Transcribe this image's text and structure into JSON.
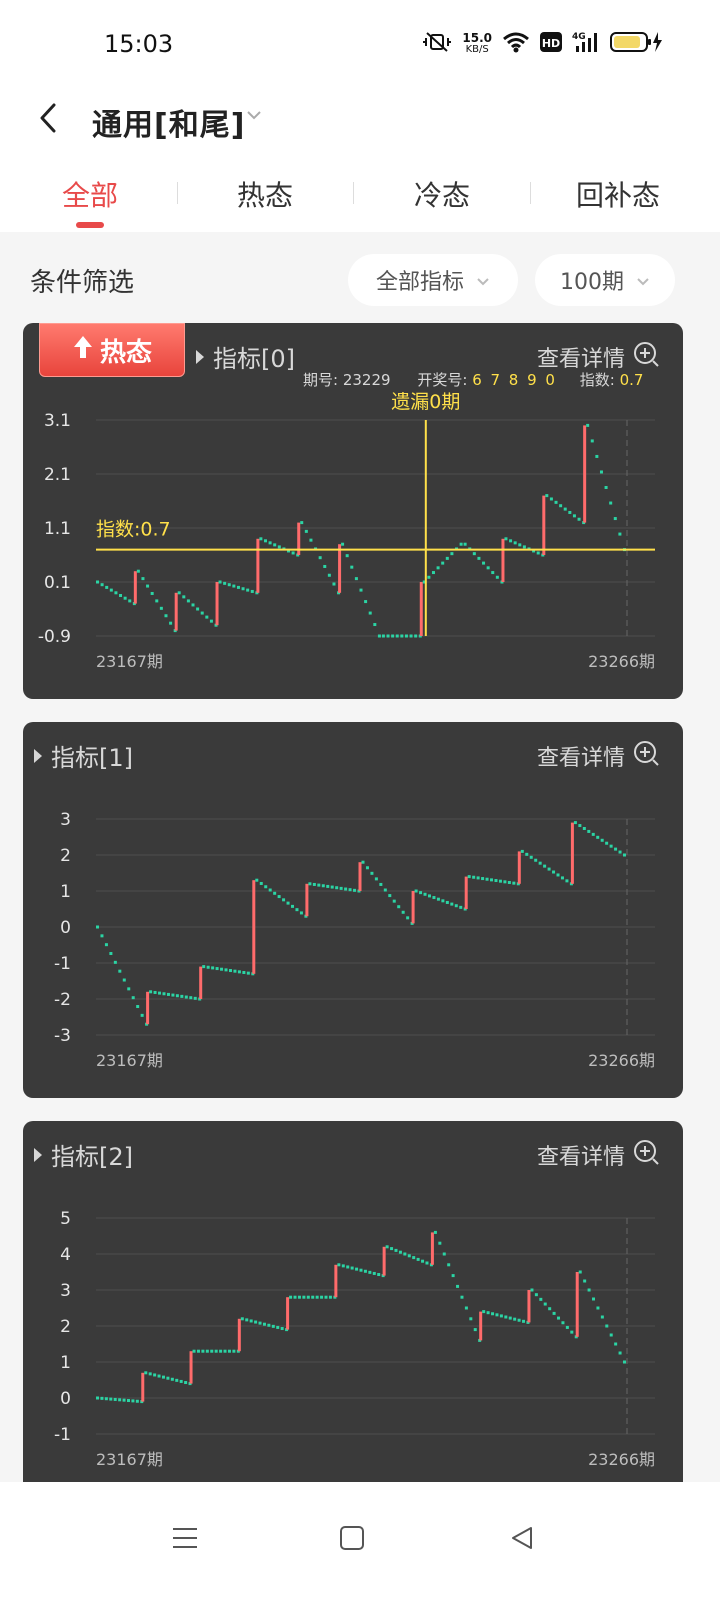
{
  "status": {
    "time": "15:03",
    "net_speed": "15.0",
    "net_unit": "KB/S",
    "hd_label": "HD",
    "signal_label": "4G"
  },
  "header": {
    "title": "通用[和尾]",
    "back_icon": "back-arrow-icon",
    "dropdown_icon": "chevron-down-icon"
  },
  "tabs": [
    {
      "label": "全部",
      "active": true
    },
    {
      "label": "热态",
      "active": false
    },
    {
      "label": "冷态",
      "active": false
    },
    {
      "label": "回补态",
      "active": false
    }
  ],
  "filter": {
    "label": "条件筛选",
    "indicator_select": "全部指标",
    "period_select": "100期"
  },
  "detail_label": "查看详情",
  "colors": {
    "accent": "#e84a4a",
    "up_bar": "#ff6b6b",
    "down_step": "#2bd4a4",
    "crosshair": "#ffe04a",
    "panel_bg": "#3a3a3a"
  },
  "panels": [
    {
      "title": "指标[0]",
      "badge": "热态",
      "info": {
        "period_label": "期号:",
        "period": "23229",
        "draw_label": "开奖号:",
        "draw": "6 7 8 9 0",
        "index_label": "指数:",
        "index": "0.7"
      },
      "miss_label": "遗漏0期",
      "ref_label": "指数:0.7",
      "start_label": "23167期",
      "end_label": "23266期"
    },
    {
      "title": "指标[1]",
      "start_label": "23167期",
      "end_label": "23266期"
    },
    {
      "title": "指标[2]",
      "start_label": "23167期",
      "end_label": "23266期"
    }
  ],
  "chart_data": [
    {
      "type": "line",
      "title": "指标[0]",
      "x": [
        "23167期",
        "23266期"
      ],
      "y_ticks": [
        3.1,
        2.1,
        1.1,
        0.1,
        -0.9
      ],
      "ylim": [
        -0.9,
        3.1
      ],
      "grid": true,
      "reference_line": 0.7,
      "crosshair_period": "23229",
      "segments": [
        {
          "from": 0.1,
          "to": -0.3,
          "up_to": 0.3
        },
        {
          "from": 0.3,
          "to": -0.8,
          "up_to": -0.1
        },
        {
          "from": -0.1,
          "to": -0.7,
          "up_to": 0.1
        },
        {
          "from": 0.1,
          "to": -0.1,
          "up_to": 0.9
        },
        {
          "from": 0.9,
          "to": 0.6,
          "up_to": 1.2
        },
        {
          "from": 1.2,
          "to": -0.1,
          "up_to": 0.8
        },
        {
          "from": 0.8,
          "to": -0.9,
          "up_to": -0.9
        },
        {
          "from": -0.9,
          "to": -0.9,
          "up_to": 0.1
        },
        {
          "from": 0.1,
          "to": 0.8,
          "up_to": 0.8
        },
        {
          "from": 0.8,
          "to": 0.1,
          "up_to": 0.9
        },
        {
          "from": 0.9,
          "to": 0.6,
          "up_to": 1.7
        },
        {
          "from": 1.7,
          "to": 1.2,
          "up_to": 3.0
        },
        {
          "from": 3.0,
          "to": 0.7,
          "up_to": 0.7
        }
      ]
    },
    {
      "type": "line",
      "title": "指标[1]",
      "x": [
        "23167期",
        "23266期"
      ],
      "y_ticks": [
        3,
        2,
        1,
        0,
        -1,
        -2,
        -3
      ],
      "ylim": [
        -3,
        3
      ],
      "grid": true,
      "segments": [
        {
          "from": 0.0,
          "to": -2.7,
          "up_to": -1.8
        },
        {
          "from": -1.8,
          "to": -2.0,
          "up_to": -1.1
        },
        {
          "from": -1.1,
          "to": -1.3,
          "up_to": 1.3
        },
        {
          "from": 1.3,
          "to": 0.3,
          "up_to": 1.2
        },
        {
          "from": 1.2,
          "to": 1.0,
          "up_to": 1.8
        },
        {
          "from": 1.8,
          "to": 0.1,
          "up_to": 1.0
        },
        {
          "from": 1.0,
          "to": 0.5,
          "up_to": 1.4
        },
        {
          "from": 1.4,
          "to": 1.2,
          "up_to": 2.1
        },
        {
          "from": 2.1,
          "to": 1.2,
          "up_to": 2.9
        },
        {
          "from": 2.9,
          "to": 2.0,
          "up_to": 2.0
        }
      ]
    },
    {
      "type": "line",
      "title": "指标[2]",
      "x": [
        "23167期",
        "23266期"
      ],
      "y_ticks": [
        5,
        4,
        3,
        2,
        1,
        0,
        -1
      ],
      "ylim": [
        -1,
        5
      ],
      "grid": true,
      "segments": [
        {
          "from": 0.0,
          "to": -0.1,
          "up_to": 0.7
        },
        {
          "from": 0.7,
          "to": 0.4,
          "up_to": 1.3
        },
        {
          "from": 1.3,
          "to": 1.3,
          "up_to": 2.2
        },
        {
          "from": 2.2,
          "to": 1.9,
          "up_to": 2.8
        },
        {
          "from": 2.8,
          "to": 2.8,
          "up_to": 3.7
        },
        {
          "from": 3.7,
          "to": 3.4,
          "up_to": 4.2
        },
        {
          "from": 4.2,
          "to": 3.7,
          "up_to": 4.6
        },
        {
          "from": 4.6,
          "to": 1.6,
          "up_to": 2.4
        },
        {
          "from": 2.4,
          "to": 2.1,
          "up_to": 3.0
        },
        {
          "from": 3.0,
          "to": 1.7,
          "up_to": 3.5
        },
        {
          "from": 3.5,
          "to": 1.0,
          "up_to": 1.0
        }
      ]
    }
  ]
}
